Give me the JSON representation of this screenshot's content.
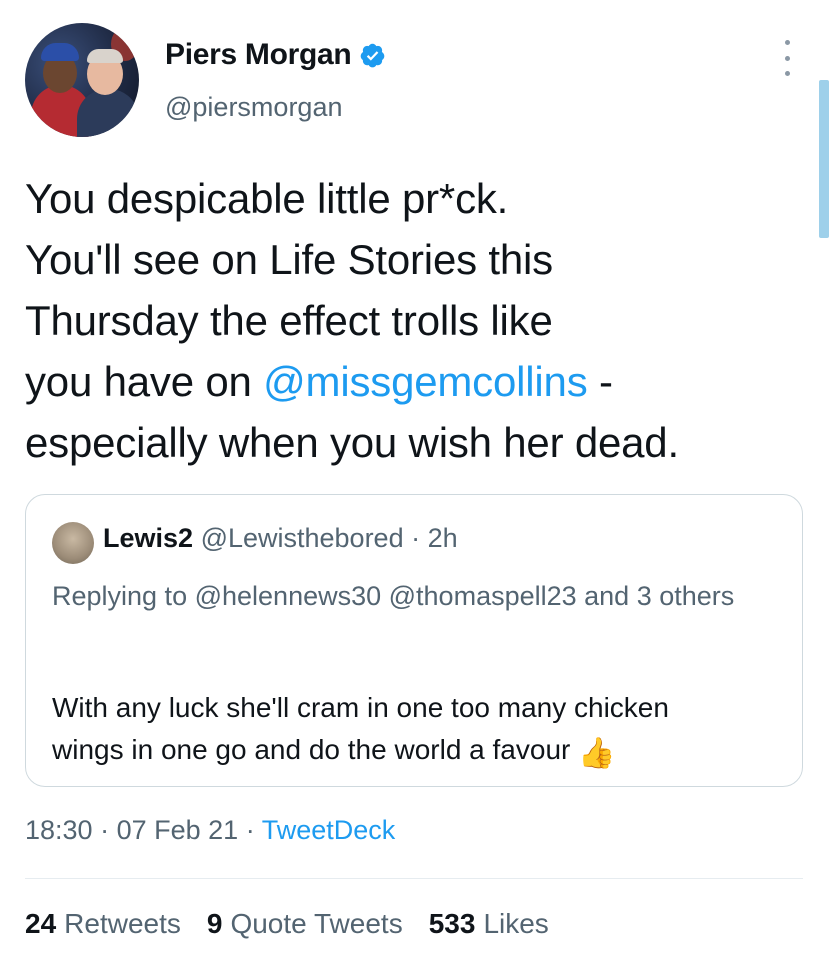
{
  "author": {
    "name": "Piers Morgan",
    "handle": "@piersmorgan",
    "verified": true
  },
  "tweet": {
    "lines": [
      "You despicable little pr*ck.",
      "You'll see on Life Stories this",
      "Thursday the effect trolls like"
    ],
    "line4_prefix": "you have on ",
    "line4_mention": "@missgemcollins",
    "line4_suffix": " -",
    "line5": "especially when you wish her dead."
  },
  "quoted_tweet": {
    "name": "Lewis2",
    "handle": "@Lewisthebored",
    "time": "2h",
    "replying_prefix": "Replying to ",
    "replying_to": "@helennews30 @thomaspell23 and 3 others",
    "body_line1": "With any luck she'll cram in one too many chicken",
    "body_line2": "wings in one go and do the world a favour",
    "emoji": "👍"
  },
  "meta": {
    "time": "18:30",
    "date": "07 Feb 21",
    "source": "TweetDeck"
  },
  "stats": {
    "retweets_count": "24",
    "retweets_label": "Retweets",
    "quotes_count": "9",
    "quotes_label": "Quote Tweets",
    "likes_count": "533",
    "likes_label": "Likes"
  },
  "colors": {
    "accent": "#1d9bf0",
    "secondary_text": "#536471",
    "primary_text": "#0f1419"
  },
  "icons": {
    "verified": "verified-badge-icon",
    "more": "more-options-icon"
  }
}
